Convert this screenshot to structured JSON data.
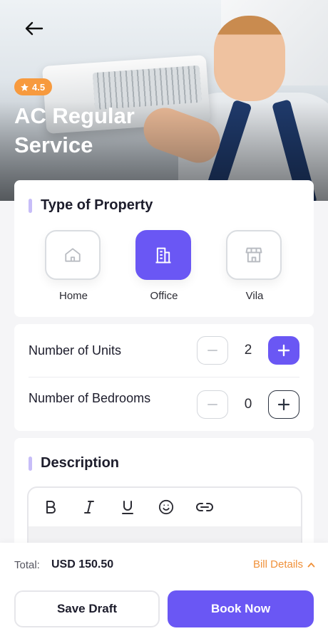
{
  "hero": {
    "title": "AC Regular Service",
    "rating": "4.5",
    "icons": {
      "back": "arrow-left-icon",
      "rating": "star-icon"
    }
  },
  "property": {
    "title": "Type of Property",
    "options": [
      {
        "label": "Home",
        "icon": "home-icon",
        "selected": false
      },
      {
        "label": "Office",
        "icon": "building-icon",
        "selected": true
      },
      {
        "label": "Vila",
        "icon": "store-icon",
        "selected": false
      }
    ]
  },
  "counts": [
    {
      "label": "Number of Units",
      "value": "2"
    },
    {
      "label": "Number of Bedrooms",
      "value": "0"
    }
  ],
  "description": {
    "title": "Description",
    "toolbar": [
      "bold-icon",
      "italic-icon",
      "underline-icon",
      "emoji-icon",
      "link-icon"
    ]
  },
  "footer": {
    "total_label": "Total:",
    "total_value": "USD 150.50",
    "bill_details": "Bill Details",
    "save_draft": "Save Draft",
    "book_now": "Book Now"
  },
  "colors": {
    "accent": "#6a57f4",
    "rating_badge": "#f79a3e",
    "link": "#f0913a",
    "section_bar": "#c7bdf8"
  }
}
